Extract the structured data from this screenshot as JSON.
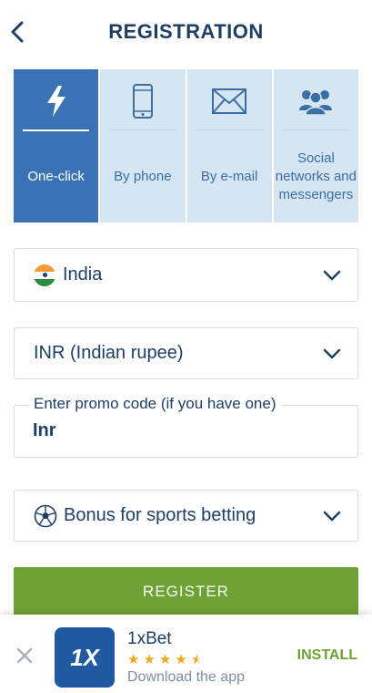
{
  "header": {
    "title": "REGISTRATION"
  },
  "tabs": [
    {
      "id": "one-click",
      "label": "One-click",
      "icon": "lightning-icon",
      "active": true
    },
    {
      "id": "phone",
      "label": "By phone",
      "icon": "phone-icon",
      "active": false
    },
    {
      "id": "email",
      "label": "By e-mail",
      "icon": "envelope-icon",
      "active": false
    },
    {
      "id": "social",
      "label": "Social networks and messengers",
      "icon": "users-icon",
      "active": false
    }
  ],
  "form": {
    "country": "India",
    "currency": "INR (Indian rupee)",
    "promo_label": "Enter promo code (if you have one)",
    "promo_value": "Inr",
    "bonus": "Bonus for sports betting"
  },
  "register_label": "REGISTER",
  "app_banner": {
    "app_name": "1xBet",
    "logo_text": "1X",
    "rating": 4.5,
    "subtitle": "Download the app",
    "install_label": "INSTALL"
  },
  "colors": {
    "primary_dark": "#1d3f66",
    "tab_active": "#3a73b4",
    "tab_inactive": "#d6e5f2",
    "register_green": "#6fa234",
    "star": "#f0a817"
  }
}
